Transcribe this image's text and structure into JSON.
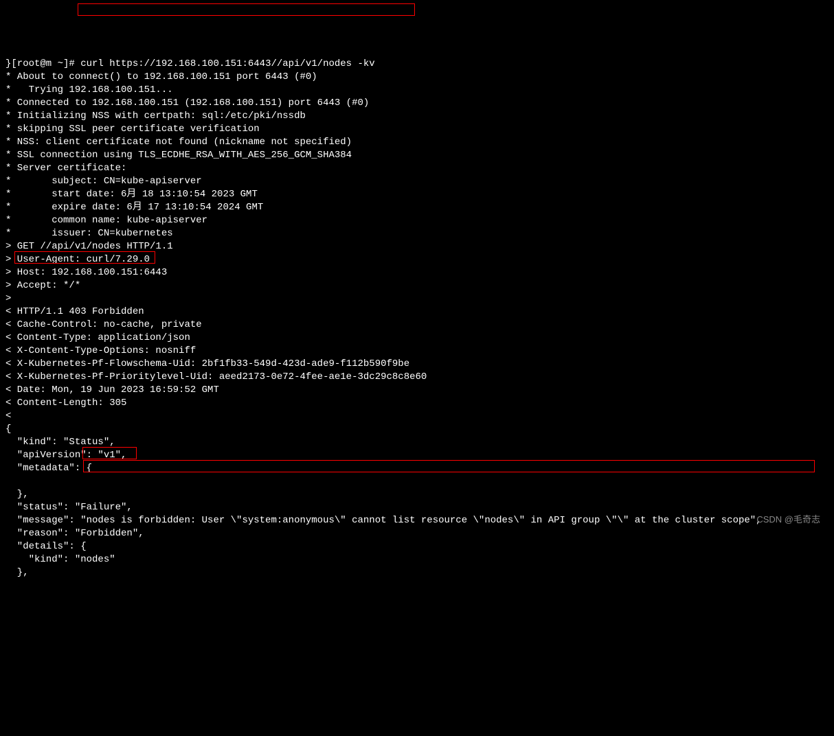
{
  "prompt": "}[root@m ~]# ",
  "command": "curl https://192.168.100.151:6443//api/v1/nodes -kv",
  "lines": {
    "l01": "* About to connect() to 192.168.100.151 port 6443 (#0)",
    "l02": "*   Trying 192.168.100.151...",
    "l03": "* Connected to 192.168.100.151 (192.168.100.151) port 6443 (#0)",
    "l04": "* Initializing NSS with certpath: sql:/etc/pki/nssdb",
    "l05": "* skipping SSL peer certificate verification",
    "l06": "* NSS: client certificate not found (nickname not specified)",
    "l07": "* SSL connection using TLS_ECDHE_RSA_WITH_AES_256_GCM_SHA384",
    "l08": "* Server certificate:",
    "l09": "*       subject: CN=kube-apiserver",
    "l10": "*       start date: 6月 18 13:10:54 2023 GMT",
    "l11": "*       expire date: 6月 17 13:10:54 2024 GMT",
    "l12": "*       common name: kube-apiserver",
    "l13": "*       issuer: CN=kubernetes",
    "l14": "> GET //api/v1/nodes HTTP/1.1",
    "l15": "> User-Agent: curl/7.29.0",
    "l16": "> Host: 192.168.100.151:6443",
    "l17": "> Accept: */*",
    "l18": ">",
    "l19": "< HTTP/1.1 403 Forbidden",
    "l20": "< Cache-Control: no-cache, private",
    "l21": "< Content-Type: application/json",
    "l22": "< X-Content-Type-Options: nosniff",
    "l23": "< X-Kubernetes-Pf-Flowschema-Uid: 2bf1fb33-549d-423d-ade9-f112b590f9be",
    "l24": "< X-Kubernetes-Pf-Prioritylevel-Uid: aeed2173-0e72-4fee-ae1e-3dc29c8c8e60",
    "l25": "< Date: Mon, 19 Jun 2023 16:59:52 GMT",
    "l26": "< Content-Length: 305",
    "l27": "<",
    "l28": "{",
    "l29": "  \"kind\": \"Status\",",
    "l30": "  \"apiVersion\": \"v1\",",
    "l31": "  \"metadata\": {",
    "l32": "    ",
    "l33": "  },",
    "l34": "  \"status\": \"Failure\",",
    "l35": "  \"message\": \"nodes is forbidden: User \\\"system:anonymous\\\" cannot list resource \\\"nodes\\\" in API group \\\"\\\" at the cluster scope\",",
    "l36": "  \"reason\": \"Forbidden\",",
    "l37": "  \"details\": {",
    "l38": "    \"kind\": \"nodes\"",
    "l39": "  },"
  },
  "watermark": "CSDN @毛奇志"
}
